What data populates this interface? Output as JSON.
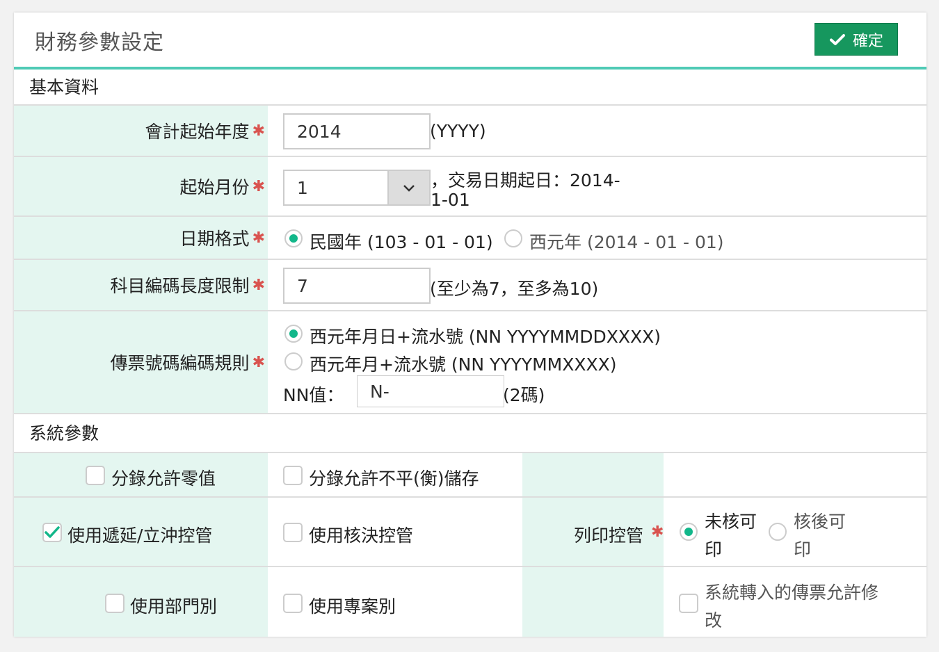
{
  "header": {
    "title": "財務參數設定",
    "confirm_label": "確定"
  },
  "sections": {
    "basic": "基本資料",
    "system": "系統參數"
  },
  "basic": {
    "fiscal_year": {
      "label": "會計起始年度",
      "value": "2014",
      "hint": "(YYYY)"
    },
    "start_month": {
      "label": "起始月份",
      "value": "1",
      "hint_line1": "，交易日期起日：2014-",
      "hint_line2": "1-01"
    },
    "date_format": {
      "label": "日期格式",
      "options": [
        {
          "label": "民國年 (103 - 01 - 01)",
          "selected": true
        },
        {
          "label": "西元年 (2014 - 01 - 01)",
          "selected": false
        }
      ]
    },
    "account_code_length": {
      "label": "科目編碼長度限制",
      "value": "7",
      "hint": "(至少為7，至多為10)"
    },
    "voucher_rule": {
      "label": "傳票號碼編碼規則",
      "options": [
        {
          "label": "西元年月日+流水號 (NN YYYYMMDDXXXX)",
          "selected": true
        },
        {
          "label": "西元年月+流水號 (NN YYYYMMXXXX)",
          "selected": false
        }
      ],
      "nn_label": "NN值：",
      "nn_value": "N-",
      "nn_hint": "(2碼)"
    }
  },
  "system": {
    "zero_entry": {
      "label": "分錄允許零值",
      "checked": false
    },
    "unbalanced_save": {
      "label": "分錄允許不平(衡)儲存",
      "checked": false
    },
    "deferral_control": {
      "label": "使用遞延/立沖控管",
      "checked": true
    },
    "approval_control": {
      "label": "使用核決控管",
      "checked": false
    },
    "print_control": {
      "label": "列印控管",
      "options": [
        {
          "line1": "未核可",
          "line2": "印",
          "selected": true
        },
        {
          "line1": "核後可",
          "line2": "印",
          "selected": false
        }
      ]
    },
    "use_department": {
      "label": "使用部門別",
      "checked": false
    },
    "use_project": {
      "label": "使用專案別",
      "checked": false
    },
    "imported_voucher_edit": {
      "line1": "系統轉入的傳票允許修",
      "line2": "改",
      "checked": false
    }
  },
  "icons": {
    "confirm": "check-icon",
    "select": "chevron-down-icon",
    "required": "asterisk-icon"
  },
  "colors": {
    "accent": "#4fcab5",
    "label_bg": "#e4f6f0",
    "button": "#16975e",
    "radio_on": "#12b78a",
    "required": "#d9534f"
  }
}
